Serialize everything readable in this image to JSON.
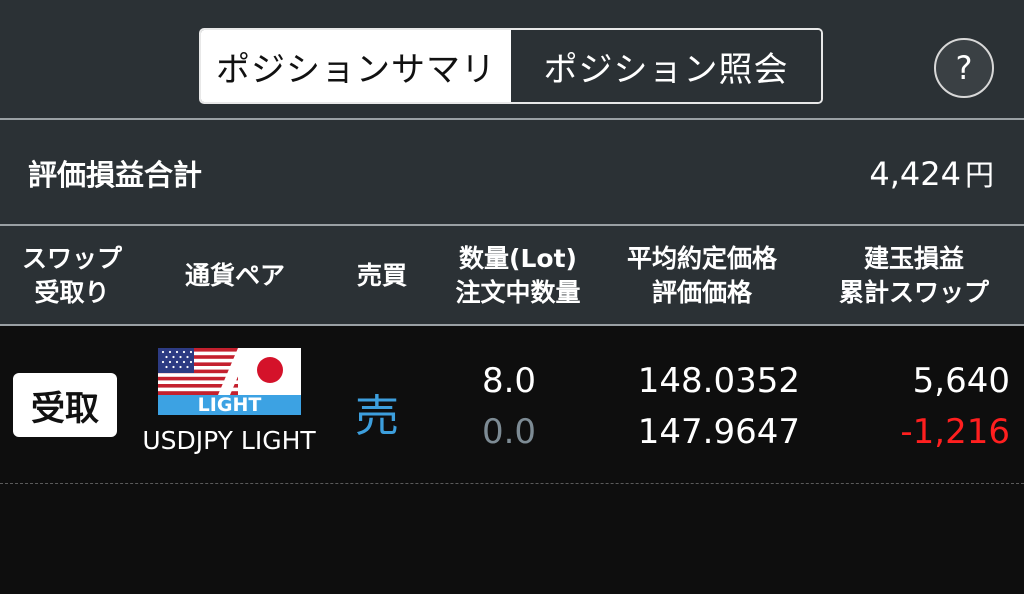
{
  "tabs": {
    "summary_label": "ポジションサマリ",
    "inquiry_label": "ポジション照会"
  },
  "help": {
    "label": "?"
  },
  "total": {
    "label": "評価損益合計",
    "value": "4,424",
    "unit": "円"
  },
  "columns": {
    "swap_line1": "スワップ",
    "swap_line2": "受取り",
    "pair": "通貨ペア",
    "side": "売買",
    "qty_line1": "数量(Lot)",
    "qty_line2": "注文中数量",
    "price_line1": "平均約定価格",
    "price_line2": "評価価格",
    "pl_line1": "建玉損益",
    "pl_line2": "累計スワップ"
  },
  "rows": [
    {
      "receive_label": "受取",
      "flag_badge": "LIGHT",
      "pair": "USDJPY LIGHT",
      "side": "売",
      "quantity": "8.0",
      "ordering_quantity": "0.0",
      "avg_price": "148.0352",
      "eval_price": "147.9647",
      "position_pl": "5,640",
      "cumulative_swap": "-1,216"
    }
  ],
  "colors": {
    "header_bg": "#2b3135",
    "body_bg": "#0e0e0e",
    "sell_blue": "#3d9fdd",
    "negative_red": "#ff1f1f",
    "muted_gray": "#7d8b94"
  }
}
